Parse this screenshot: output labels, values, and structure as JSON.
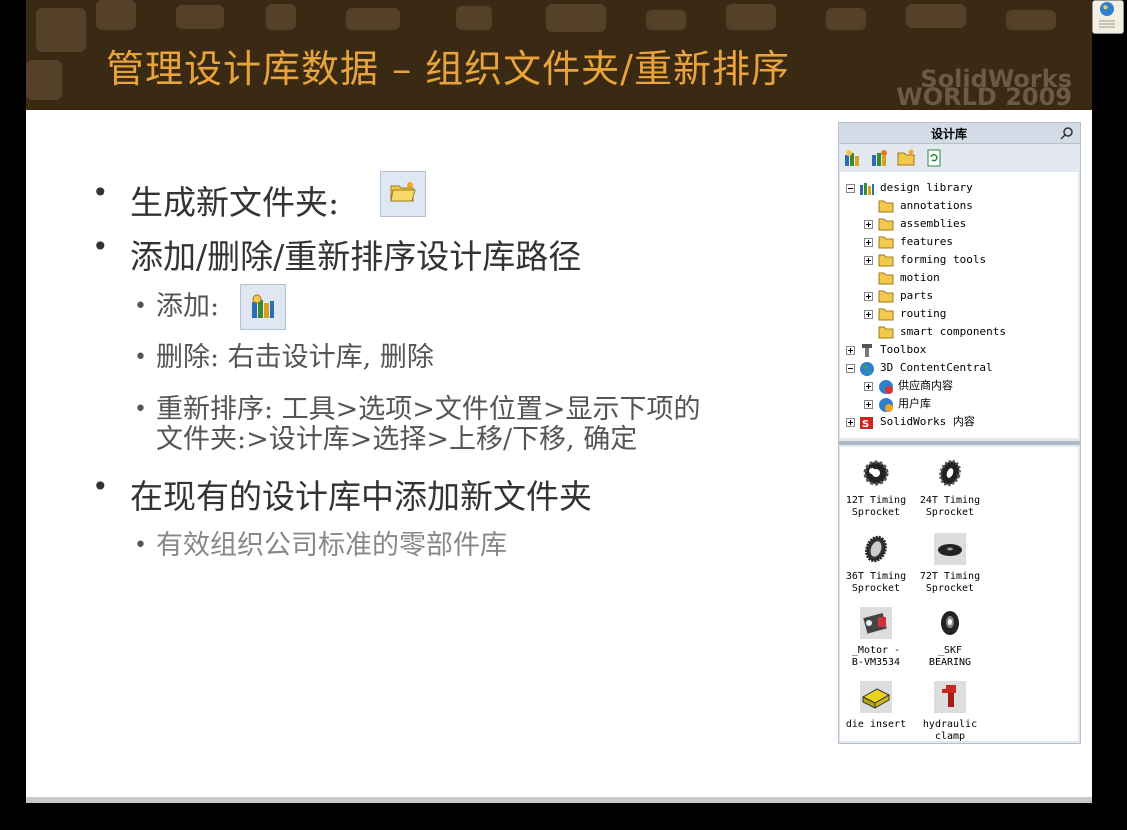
{
  "slide": {
    "title": "管理设计库数据 – 组织文件夹/重新排序",
    "brand_line1": "SolidWorks",
    "brand_line2": "WORLD 2009",
    "bullets": {
      "b1": "生成新文件夹:",
      "b2": "添加/删除/重新排序设计库路径",
      "b2_add": "添加:",
      "b2_delete": "删除: 右击设计库, 删除",
      "b2_reorder_1": "重新排序: 工具>选项>文件位置>显示下项的",
      "b2_reorder_2": "文件夹:>设计库>选择>上移/下移, 确定",
      "b3": "在现有的设计库中添加新文件夹",
      "b3_sub": "有效组织公司标准的零部件库"
    }
  },
  "panel": {
    "title": "设计库",
    "toolbar_icons": [
      "add-library-icon",
      "add-path-icon",
      "new-folder-icon",
      "refresh-icon"
    ],
    "tree": [
      {
        "label": "design library",
        "icon": "library-icon",
        "level": 0,
        "state": "expanded"
      },
      {
        "label": "annotations",
        "icon": "folder-icon",
        "level": 1,
        "state": "none"
      },
      {
        "label": "assemblies",
        "icon": "folder-icon",
        "level": 1,
        "state": "collapsed"
      },
      {
        "label": "features",
        "icon": "folder-icon",
        "level": 1,
        "state": "collapsed"
      },
      {
        "label": "forming tools",
        "icon": "folder-icon",
        "level": 1,
        "state": "collapsed"
      },
      {
        "label": "motion",
        "icon": "folder-icon",
        "level": 1,
        "state": "none"
      },
      {
        "label": "parts",
        "icon": "folder-icon",
        "level": 1,
        "state": "collapsed"
      },
      {
        "label": "routing",
        "icon": "folder-icon",
        "level": 1,
        "state": "collapsed"
      },
      {
        "label": "smart components",
        "icon": "folder-icon",
        "level": 1,
        "state": "none"
      },
      {
        "label": "Toolbox",
        "icon": "toolbox-icon",
        "level": 0,
        "state": "collapsed"
      },
      {
        "label": "3D ContentCentral",
        "icon": "globe-icon",
        "level": 0,
        "state": "expanded"
      },
      {
        "label": "供应商内容",
        "icon": "globe-icon",
        "level": 1,
        "state": "collapsed"
      },
      {
        "label": "用户库",
        "icon": "globe-icon",
        "level": 1,
        "state": "collapsed"
      },
      {
        "label": "SolidWorks 内容",
        "icon": "solidworks-icon",
        "level": 0,
        "state": "collapsed"
      }
    ],
    "items": [
      {
        "caption": "12T Timing\nSprocket",
        "icon": "sprocket-icon"
      },
      {
        "caption": "24T Timing\nSprocket",
        "icon": "sprocket-icon"
      },
      {
        "caption": "36T Timing\nSprocket",
        "icon": "sprocket-icon"
      },
      {
        "caption": "72T Timing\nSprocket",
        "icon": "sprocket-icon"
      },
      {
        "caption": "_Motor -\nB-VM3534",
        "icon": "motor-icon"
      },
      {
        "caption": "_SKF\nBEARING",
        "icon": "bearing-icon"
      },
      {
        "caption": "die insert",
        "icon": "die-insert-icon"
      },
      {
        "caption": "hydraulic\nclamp",
        "icon": "clamp-icon"
      }
    ]
  },
  "colors": {
    "banner": "#3a2a14",
    "title": "#e8a33a",
    "folder": "#f2c94c",
    "body_text": "#333333"
  }
}
